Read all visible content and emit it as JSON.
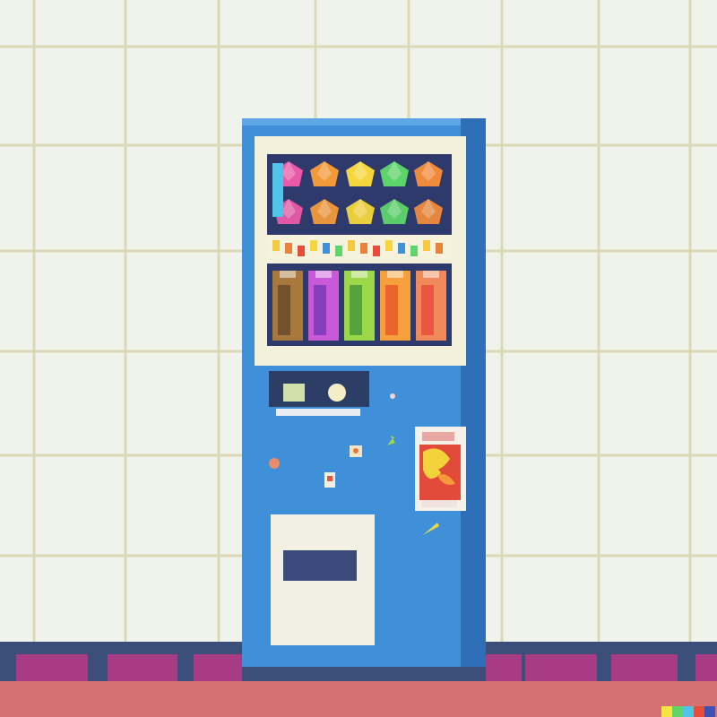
{
  "scene": {
    "subject": "vending-machine",
    "style": "flat digital illustration",
    "colors": {
      "wall": "#f0f3ec",
      "grout": "#dcd8b6",
      "machine_body": "#3f8fd9",
      "machine_side": "#2f6fb8",
      "machine_trim": "#5ea6e6",
      "window_frame": "#f3f0dc",
      "window_dark": "#2d3a6b",
      "control_panel": "#2c3e66",
      "dispense_panel": "#f2efe3",
      "dispense_slot": "#3a4a7a",
      "baseboard_navy": "#3b4f7a",
      "baseboard_magenta": "#a73c84",
      "floor": "#d47272"
    },
    "palette_swatch": [
      "#f5e642",
      "#5fd46a",
      "#4fc3e8",
      "#e84d3c",
      "#3f51b5"
    ]
  }
}
